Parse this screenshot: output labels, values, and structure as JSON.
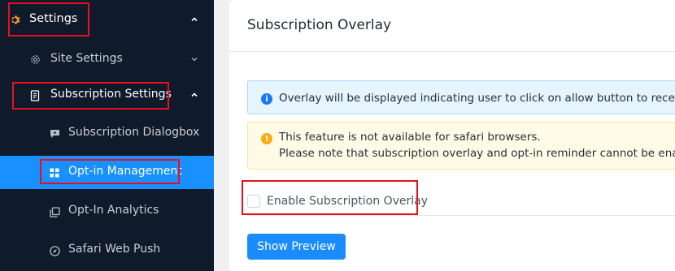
{
  "sidebar": {
    "settings": {
      "label": "Settings",
      "icon": "gear-icon"
    },
    "site_settings": {
      "label": "Site Settings",
      "icon": "gear-icon"
    },
    "subscription_settings": {
      "label": "Subscription Settings",
      "icon": "document-icon"
    },
    "subscription_dialogbox": {
      "label": "Subscription Dialogbox",
      "icon": "chat-icon"
    },
    "optin_management": {
      "label": "Opt-in Management",
      "icon": "grid-icon"
    },
    "optin_analytics": {
      "label": "Opt-In Analytics",
      "icon": "copy-icon"
    },
    "safari_web_push": {
      "label": "Safari Web Push",
      "icon": "compass-icon"
    }
  },
  "main": {
    "title": "Subscription Overlay",
    "info_alert": "Overlay will be displayed indicating user to click on allow button to receive pu",
    "warning_alert_line1": "This feature is not available for safari browsers.",
    "warning_alert_line2": "Please note that subscription overlay and opt-in reminder cannot be enabled",
    "checkbox_label": "Enable Subscription Overlay",
    "checkbox_checked": false,
    "preview_button": "Show Preview"
  },
  "colors": {
    "sidebar_bg": "#0f1a2a",
    "active_item": "#1990ff",
    "highlight_border": "#e8101e",
    "info_bg": "#e6f4ff",
    "warning_bg": "#fffbe6",
    "button_bg": "#1a8cff"
  }
}
